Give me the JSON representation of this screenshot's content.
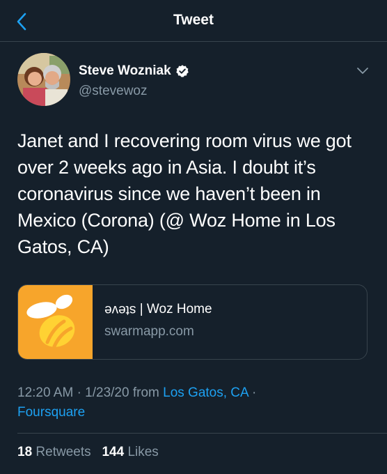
{
  "header": {
    "title": "Tweet",
    "back_icon": "chevron-left-icon"
  },
  "author": {
    "display_name": "Steve Wozniak",
    "handle": "@stevewoz",
    "verified_icon": "verified-badge-icon",
    "menu_icon": "chevron-down-icon"
  },
  "tweet": {
    "text": "Janet and I recovering  room virus we got over 2 weeks ago in Asia. I doubt it’s coronavirus since we haven’t been in Mexico (Corona) (@ Woz Home in Los Gatos, CA)"
  },
  "card": {
    "title_mirrored": "steve",
    "title_apple": "",
    "title_rest": " | Woz Home",
    "domain": "swarmapp.com",
    "thumb_icon": "swarm-bee-icon"
  },
  "meta": {
    "time": "12:20 AM",
    "date": "1/23/20",
    "from_word": "from",
    "location": "Los Gatos, CA",
    "separator": "·",
    "source": "Foursquare"
  },
  "stats": {
    "retweets_count": "18",
    "retweets_label": "Retweets",
    "likes_count": "144",
    "likes_label": "Likes"
  },
  "colors": {
    "background": "#15202b",
    "accent": "#1da1f2",
    "secondary_text": "#8899a6",
    "border": "#38444d",
    "swarm_orange": "#f7a52b"
  }
}
